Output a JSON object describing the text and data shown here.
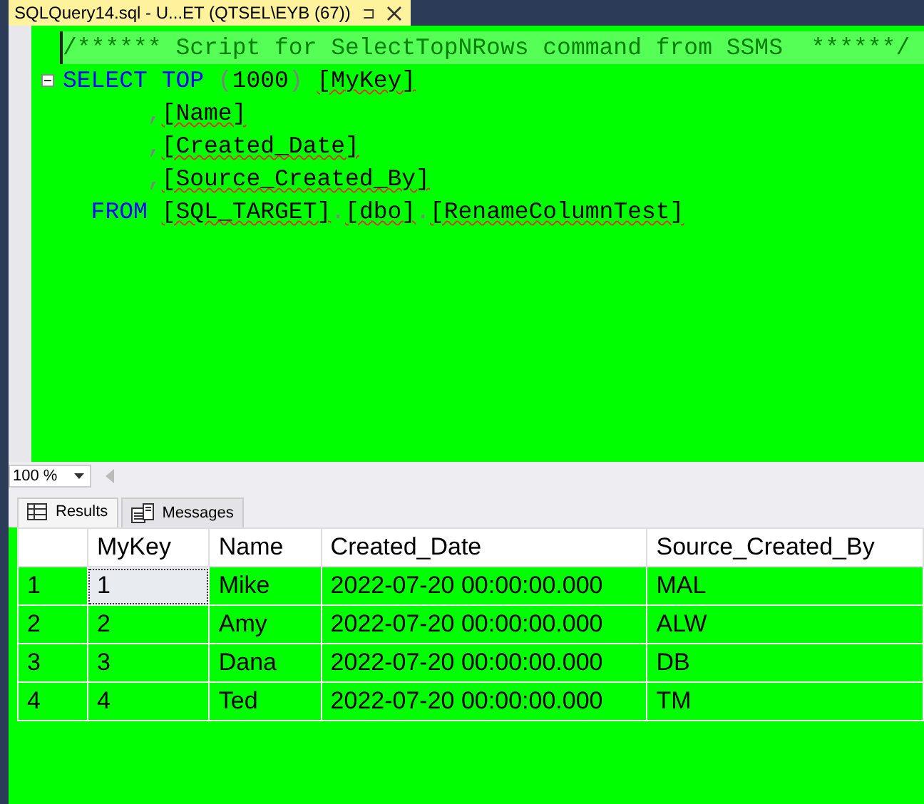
{
  "document_tab": {
    "title": "SQLQuery14.sql - U...ET (QTSEL\\EYB (67))",
    "pin": "⊐"
  },
  "editor": {
    "lines": [
      {
        "highlighted": true,
        "collapsible": false,
        "tokens": [
          {
            "text": "/****** Script for SelectTopNRows command from SSMS  ******/",
            "kind": "comment"
          }
        ]
      },
      {
        "highlighted": false,
        "collapsible": true,
        "tokens": [
          {
            "text": "SELECT ",
            "kind": "keyword"
          },
          {
            "text": "TOP",
            "kind": "keyword"
          },
          {
            "text": " (",
            "kind": "punct"
          },
          {
            "text": "1000",
            "kind": "plain"
          },
          {
            "text": ") ",
            "kind": "punct"
          },
          {
            "text": "[MyKey]",
            "kind": "ident"
          }
        ]
      },
      {
        "highlighted": false,
        "collapsible": false,
        "tokens": [
          {
            "text": "      ,",
            "kind": "punct"
          },
          {
            "text": "[Name]",
            "kind": "ident"
          }
        ]
      },
      {
        "highlighted": false,
        "collapsible": false,
        "tokens": [
          {
            "text": "      ,",
            "kind": "punct"
          },
          {
            "text": "[Created_Date]",
            "kind": "ident"
          }
        ]
      },
      {
        "highlighted": false,
        "collapsible": false,
        "tokens": [
          {
            "text": "      ,",
            "kind": "punct"
          },
          {
            "text": "[Source_Created_By]",
            "kind": "ident"
          }
        ]
      },
      {
        "highlighted": false,
        "collapsible": false,
        "tokens": [
          {
            "text": "  FROM ",
            "kind": "keyword"
          },
          {
            "text": "[SQL_TARGET]",
            "kind": "ident"
          },
          {
            "text": ".",
            "kind": "punct"
          },
          {
            "text": "[dbo]",
            "kind": "ident"
          },
          {
            "text": ".",
            "kind": "punct"
          },
          {
            "text": "[RenameColumnTest]",
            "kind": "ident"
          }
        ]
      }
    ]
  },
  "zoom": {
    "value": "100 %"
  },
  "result_tabs": [
    {
      "label": "Results",
      "selected": true,
      "kind": "grid"
    },
    {
      "label": "Messages",
      "selected": false,
      "kind": "messages"
    }
  ],
  "grid": {
    "columns": [
      "MyKey",
      "Name",
      "Created_Date",
      "Source_Created_By"
    ],
    "rows": [
      {
        "number": "1",
        "cells": [
          {
            "text": "1",
            "selected": true
          },
          {
            "text": "Mike",
            "selected": false
          },
          {
            "text": "2022-07-20 00:00:00.000",
            "selected": false
          },
          {
            "text": "MAL",
            "selected": false
          }
        ]
      },
      {
        "number": "2",
        "cells": [
          {
            "text": "2",
            "selected": false
          },
          {
            "text": "Amy",
            "selected": false
          },
          {
            "text": "2022-07-20 00:00:00.000",
            "selected": false
          },
          {
            "text": "ALW",
            "selected": false
          }
        ]
      },
      {
        "number": "3",
        "cells": [
          {
            "text": "3",
            "selected": false
          },
          {
            "text": "Dana",
            "selected": false
          },
          {
            "text": "2022-07-20 00:00:00.000",
            "selected": false
          },
          {
            "text": "DB",
            "selected": false
          }
        ]
      },
      {
        "number": "4",
        "cells": [
          {
            "text": "4",
            "selected": false
          },
          {
            "text": "Ted",
            "selected": false
          },
          {
            "text": "2022-07-20 00:00:00.000",
            "selected": false
          },
          {
            "text": "TM",
            "selected": false
          }
        ]
      }
    ]
  }
}
